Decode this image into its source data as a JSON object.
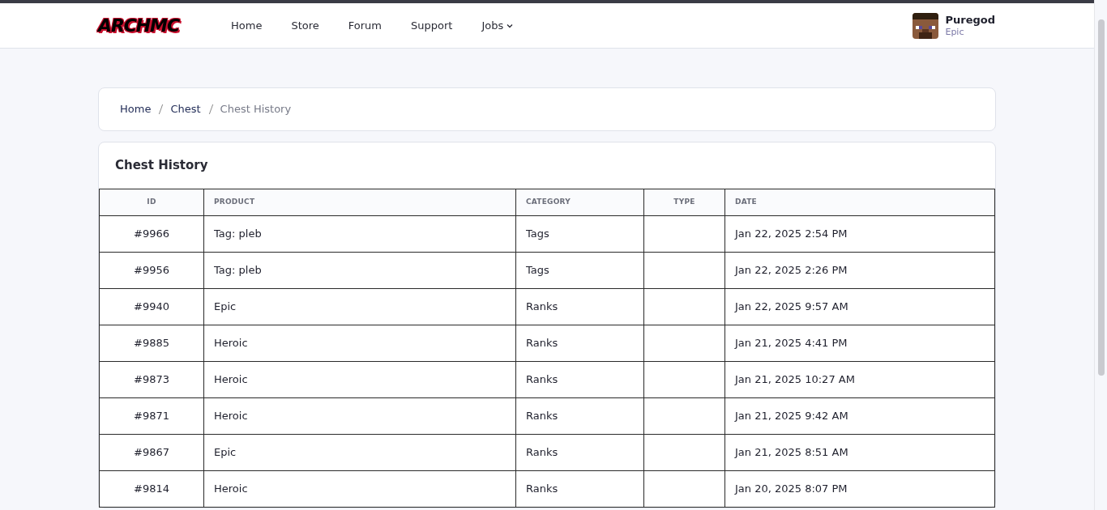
{
  "logo": "ARCHMC",
  "nav": [
    {
      "label": "Home",
      "dropdown": false
    },
    {
      "label": "Store",
      "dropdown": false
    },
    {
      "label": "Forum",
      "dropdown": false
    },
    {
      "label": "Support",
      "dropdown": false
    },
    {
      "label": "Jobs",
      "dropdown": true
    }
  ],
  "user": {
    "name": "Puregod",
    "rank": "Epic"
  },
  "breadcrumb": [
    {
      "label": "Home",
      "current": false
    },
    {
      "label": "Chest",
      "current": false
    },
    {
      "label": "Chest History",
      "current": true
    }
  ],
  "card": {
    "title": "Chest History"
  },
  "table": {
    "columns": [
      "ID",
      "PRODUCT",
      "CATEGORY",
      "TYPE",
      "DATE"
    ],
    "rows": [
      {
        "id": "#9966",
        "product": "Tag: pleb",
        "category": "Tags",
        "date": "Jan 22, 2025 2:54 PM"
      },
      {
        "id": "#9956",
        "product": "Tag: pleb",
        "category": "Tags",
        "date": "Jan 22, 2025 2:26 PM"
      },
      {
        "id": "#9940",
        "product": "Epic",
        "category": "Ranks",
        "date": "Jan 22, 2025 9:57 AM"
      },
      {
        "id": "#9885",
        "product": "Heroic",
        "category": "Ranks",
        "date": "Jan 21, 2025 4:41 PM"
      },
      {
        "id": "#9873",
        "product": "Heroic",
        "category": "Ranks",
        "date": "Jan 21, 2025 10:27 AM"
      },
      {
        "id": "#9871",
        "product": "Heroic",
        "category": "Ranks",
        "date": "Jan 21, 2025 9:42 AM"
      },
      {
        "id": "#9867",
        "product": "Epic",
        "category": "Ranks",
        "date": "Jan 21, 2025 8:51 AM"
      },
      {
        "id": "#9814",
        "product": "Heroic",
        "category": "Ranks",
        "date": "Jan 20, 2025 8:07 PM"
      }
    ]
  }
}
